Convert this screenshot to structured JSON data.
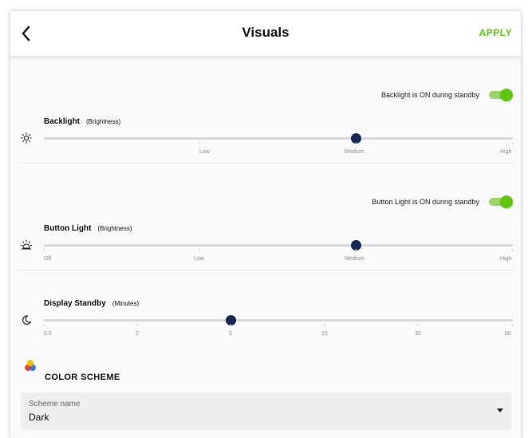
{
  "header": {
    "title": "Visuals",
    "apply_label": "APPLY"
  },
  "backlight": {
    "standby_label": "Backlight is ON during standby",
    "standby_on": true,
    "title": "Backlight",
    "subtitle": "(Brightness)",
    "value_label": "Medium",
    "ticks": [
      "Low",
      "Medium",
      "High"
    ]
  },
  "button_light": {
    "standby_label": "Button Light is ON during standby",
    "standby_on": true,
    "title": "Button Light",
    "subtitle": "(Brightness)",
    "value_label": "Medium",
    "ticks": [
      "Off",
      "Low",
      "Medium",
      "High"
    ]
  },
  "display_standby": {
    "title": "Display Standby",
    "subtitle": "(Minutes)",
    "value_label": "5",
    "ticks": [
      "0.5",
      "2",
      "5",
      "15",
      "30",
      "60"
    ]
  },
  "color_scheme": {
    "title": "COLOR SCHEME",
    "field_label": "Scheme name",
    "field_value": "Dark"
  },
  "colors": {
    "accent": "#5cc70d",
    "knob": "#172a55",
    "track": "#d7d7de"
  },
  "icons": {
    "back": "chevron-left-icon",
    "backlight": "sun-icon",
    "button_light": "button-light-icon",
    "display_standby": "moon-icon",
    "color_scheme": "palette-icon",
    "dropdown": "caret-down-icon"
  }
}
